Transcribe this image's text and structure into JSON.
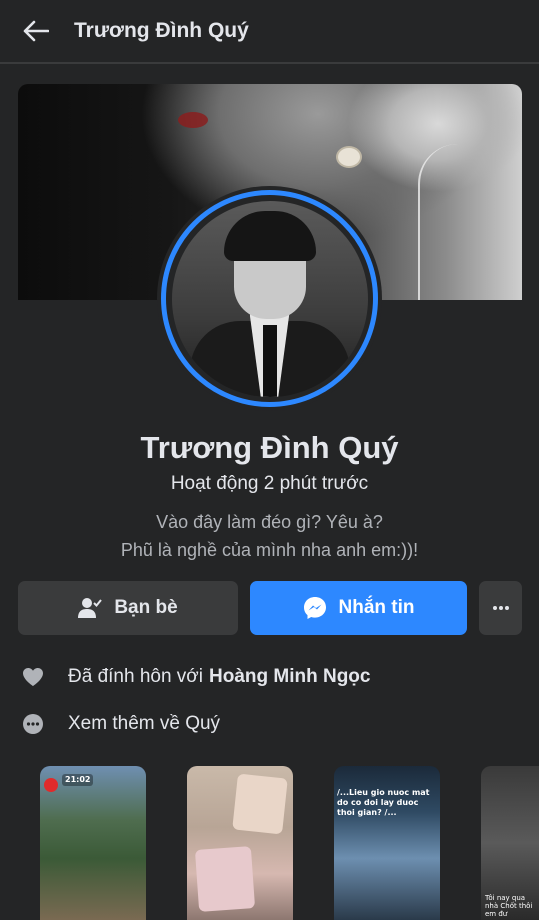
{
  "header": {
    "back_icon": "arrow-left-icon",
    "title": "Trương Đình Quý"
  },
  "profile": {
    "name": "Trương Đình Quý",
    "active_status": "Hoạt động 2 phút trước",
    "bio_line1": "Vào đây làm đéo gì? Yêu à?",
    "bio_line2": "Phũ là nghề của mình nha anh em:))!"
  },
  "actions": {
    "friends_label": "Bạn bè",
    "friends_icon": "friend-check-icon",
    "message_label": "Nhắn tin",
    "message_icon": "messenger-icon",
    "more_icon": "more-horizontal-icon"
  },
  "info": {
    "relationship_prefix": "Đã đính hôn với",
    "relationship_name": "Hoàng Minh Ngọc",
    "relationship_icon": "heart-icon",
    "see_more": "Xem thêm về Quý",
    "see_more_icon": "more-circle-icon"
  },
  "stories": [
    {
      "text": "21:02"
    },
    {
      "text": ""
    },
    {
      "text": "/...Lieu gio nuoc mat do co doi lay duoc thoi gian? /..."
    },
    {
      "text": "Tôi nay qua nhà Chốt thôi em đư"
    }
  ],
  "colors": {
    "background": "#242526",
    "accent": "#2d88ff",
    "button_secondary": "#3a3b3c",
    "text_primary": "#e4e6eb",
    "text_secondary": "#b0b3b8"
  }
}
